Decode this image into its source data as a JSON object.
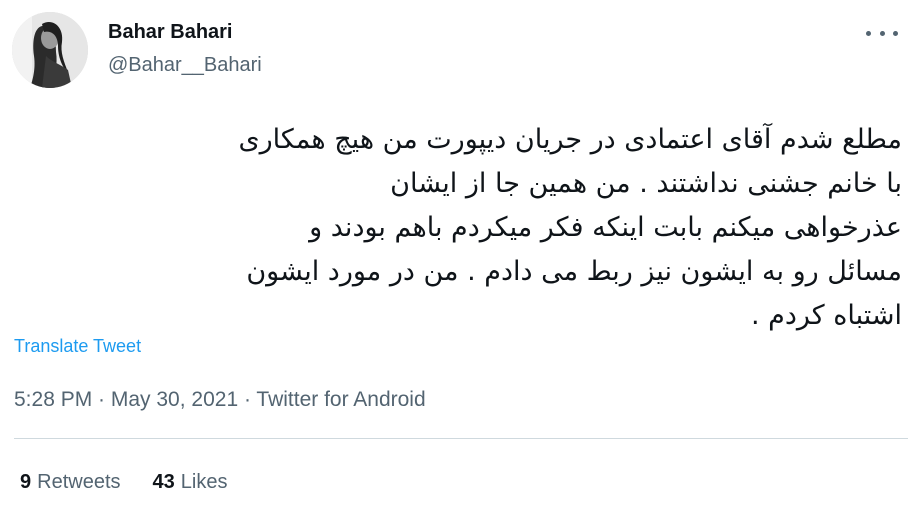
{
  "author": {
    "name": "Bahar Bahari",
    "handle": "@Bahar__Bahari",
    "avatar_icon": "profile-photo-avatar"
  },
  "more_icon": "more-dots-icon",
  "tweet": {
    "text": "مطلع شدم آقای اعتمادی در جریان دیپورت من هیچ همکاری\nبا خانم جشنی نداشتند .  من همین جا از ایشان\nعذرخواهی میکنم بابت اینکه فکر میکردم باهم بودند و\nمسائل رو به ایشون نیز ربط می دادم . من در مورد ایشون\nاشتباه کردم .",
    "translate_label": "Translate Tweet",
    "meta": "5:28 PM · May 30, 2021 · Twitter for Android"
  },
  "stats": {
    "retweets_count": "9",
    "retweets_label": "Retweets",
    "likes_count": "43",
    "likes_label": "Likes"
  },
  "colors": {
    "text": "#0f1419",
    "secondary": "#536471",
    "link": "#1d9bf0",
    "divider": "#cfd9de"
  }
}
